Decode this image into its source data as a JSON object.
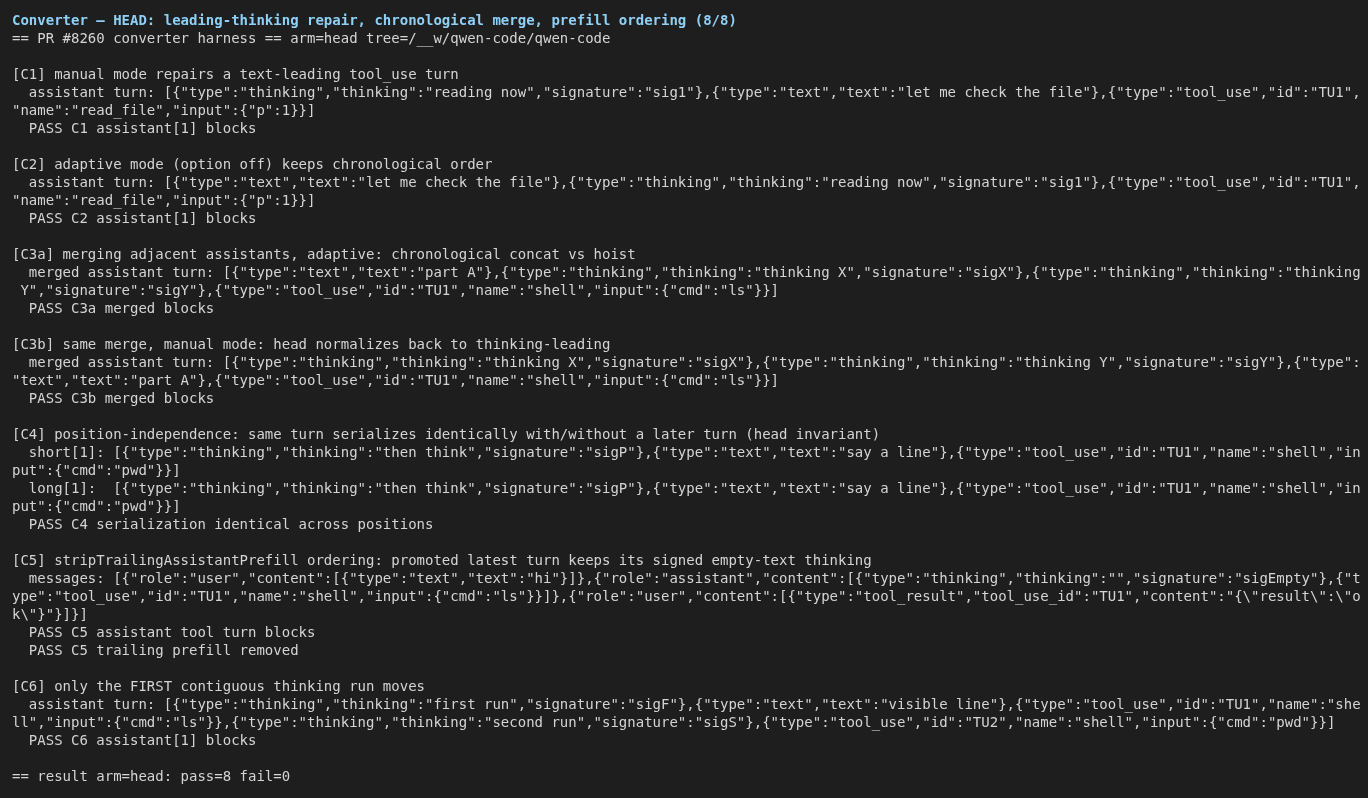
{
  "title": "Converter — HEAD: leading-thinking repair, chronological merge, prefill ordering (8/8)",
  "header": "== PR #8260 converter harness == arm=head tree=/__w/qwen-code/qwen-code",
  "sections": [
    {
      "heading": "[C1] manual mode repairs a text-leading tool_use turn",
      "lines": [
        "assistant turn: [{\"type\":\"thinking\",\"thinking\":\"reading now\",\"signature\":\"sig1\"},{\"type\":\"text\",\"text\":\"let me check the file\"},{\"type\":\"tool_use\",\"id\":\"TU1\",\"name\":\"read_file\",\"input\":{\"p\":1}}]",
        "PASS C1 assistant[1] blocks"
      ]
    },
    {
      "heading": "[C2] adaptive mode (option off) keeps chronological order",
      "lines": [
        "assistant turn: [{\"type\":\"text\",\"text\":\"let me check the file\"},{\"type\":\"thinking\",\"thinking\":\"reading now\",\"signature\":\"sig1\"},{\"type\":\"tool_use\",\"id\":\"TU1\",\"name\":\"read_file\",\"input\":{\"p\":1}}]",
        "PASS C2 assistant[1] blocks"
      ]
    },
    {
      "heading": "[C3a] merging adjacent assistants, adaptive: chronological concat vs hoist",
      "lines": [
        "merged assistant turn: [{\"type\":\"text\",\"text\":\"part A\"},{\"type\":\"thinking\",\"thinking\":\"thinking X\",\"signature\":\"sigX\"},{\"type\":\"thinking\",\"thinking\":\"thinking Y\",\"signature\":\"sigY\"},{\"type\":\"tool_use\",\"id\":\"TU1\",\"name\":\"shell\",\"input\":{\"cmd\":\"ls\"}}]",
        "PASS C3a merged blocks"
      ]
    },
    {
      "heading": "[C3b] same merge, manual mode: head normalizes back to thinking-leading",
      "lines": [
        "merged assistant turn: [{\"type\":\"thinking\",\"thinking\":\"thinking X\",\"signature\":\"sigX\"},{\"type\":\"thinking\",\"thinking\":\"thinking Y\",\"signature\":\"sigY\"},{\"type\":\"text\",\"text\":\"part A\"},{\"type\":\"tool_use\",\"id\":\"TU1\",\"name\":\"shell\",\"input\":{\"cmd\":\"ls\"}}]",
        "PASS C3b merged blocks"
      ]
    },
    {
      "heading": "[C4] position-independence: same turn serializes identically with/without a later turn (head invariant)",
      "lines": [
        "short[1]: [{\"type\":\"thinking\",\"thinking\":\"then think\",\"signature\":\"sigP\"},{\"type\":\"text\",\"text\":\"say a line\"},{\"type\":\"tool_use\",\"id\":\"TU1\",\"name\":\"shell\",\"input\":{\"cmd\":\"pwd\"}}]",
        "long[1]:  [{\"type\":\"thinking\",\"thinking\":\"then think\",\"signature\":\"sigP\"},{\"type\":\"text\",\"text\":\"say a line\"},{\"type\":\"tool_use\",\"id\":\"TU1\",\"name\":\"shell\",\"input\":{\"cmd\":\"pwd\"}}]",
        "PASS C4 serialization identical across positions"
      ]
    },
    {
      "heading": "[C5] stripTrailingAssistantPrefill ordering: promoted latest turn keeps its signed empty-text thinking",
      "lines": [
        "messages: [{\"role\":\"user\",\"content\":[{\"type\":\"text\",\"text\":\"hi\"}]},{\"role\":\"assistant\",\"content\":[{\"type\":\"thinking\",\"thinking\":\"\",\"signature\":\"sigEmpty\"},{\"type\":\"tool_use\",\"id\":\"TU1\",\"name\":\"shell\",\"input\":{\"cmd\":\"ls\"}}]},{\"role\":\"user\",\"content\":[{\"type\":\"tool_result\",\"tool_use_id\":\"TU1\",\"content\":\"{\\\"result\\\":\\\"ok\\\"}\"}]}]",
        "PASS C5 assistant tool turn blocks",
        "PASS C5 trailing prefill removed"
      ]
    },
    {
      "heading": "[C6] only the FIRST contiguous thinking run moves",
      "lines": [
        "assistant turn: [{\"type\":\"thinking\",\"thinking\":\"first run\",\"signature\":\"sigF\"},{\"type\":\"text\",\"text\":\"visible line\"},{\"type\":\"tool_use\",\"id\":\"TU1\",\"name\":\"shell\",\"input\":{\"cmd\":\"ls\"}},{\"type\":\"thinking\",\"thinking\":\"second run\",\"signature\":\"sigS\"},{\"type\":\"tool_use\",\"id\":\"TU2\",\"name\":\"shell\",\"input\":{\"cmd\":\"pwd\"}}]",
        "PASS C6 assistant[1] blocks"
      ]
    }
  ],
  "result": "== result arm=head: pass=8 fail=0"
}
